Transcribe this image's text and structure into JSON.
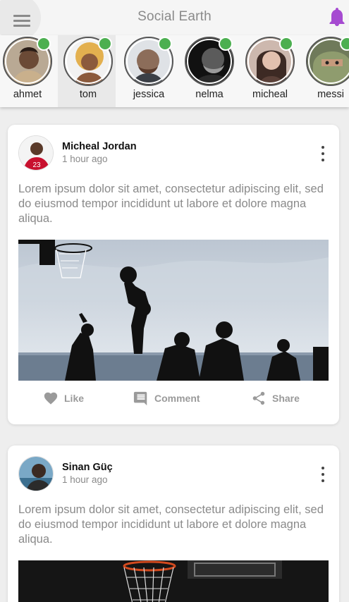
{
  "app": {
    "title": "Social Earth"
  },
  "stories": [
    {
      "name": "ahmet"
    },
    {
      "name": "tom"
    },
    {
      "name": "jessica"
    },
    {
      "name": "nelma"
    },
    {
      "name": "micheal"
    },
    {
      "name": "messi"
    }
  ],
  "posts": [
    {
      "author": "Micheal Jordan",
      "time": "1 hour ago",
      "text": "Lorem ipsum dolor sit amet, consectetur adipiscing elit, sed do eiusmod tempor incididunt ut labore et dolore magna aliqua.",
      "actions": {
        "like": "Like",
        "comment": "Comment",
        "share": "Share"
      }
    },
    {
      "author": "Sinan Güç",
      "time": "1 hour ago",
      "text": "Lorem ipsum dolor sit amet, consectetur adipiscing elit, sed do eiusmod tempor incididunt ut labore et dolore magna aliqua."
    }
  ],
  "colors": {
    "accent": "#a64bd1",
    "online": "#4caf50",
    "muted_text": "#8a8a8a"
  },
  "icons": {
    "menu": "hamburger-icon",
    "notifications": "bell-icon",
    "more": "more-vertical-icon",
    "like": "heart-icon",
    "comment": "comment-icon",
    "share": "share-icon"
  }
}
